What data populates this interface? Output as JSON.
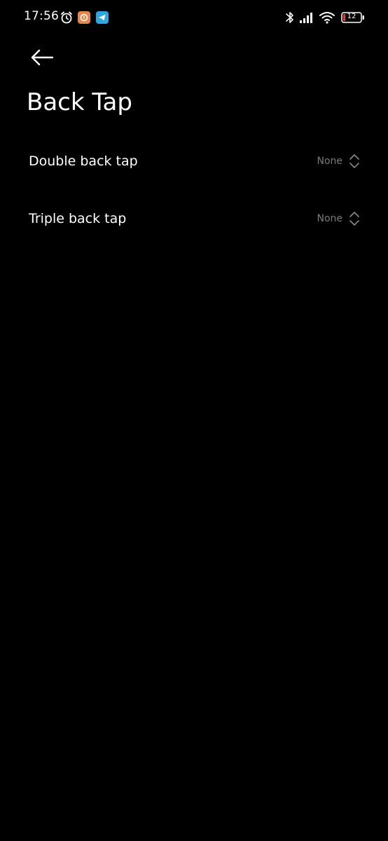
{
  "status_bar": {
    "time": "17:56",
    "battery_level": "12",
    "icons": [
      "alarm-icon",
      "app-notification-icon",
      "telegram-icon",
      "bluetooth-icon",
      "signal-icon",
      "wifi-icon",
      "battery-icon"
    ]
  },
  "header": {
    "back_icon": "arrow-left-icon",
    "title": "Back Tap"
  },
  "settings": [
    {
      "label": "Double back tap",
      "value": "None"
    },
    {
      "label": "Triple back tap",
      "value": "None"
    }
  ],
  "colors": {
    "background": "#000000",
    "text": "#ffffff",
    "secondary_text": "#7a7a7a",
    "battery_low": "#e53935",
    "notification_orange": "#e8864a",
    "telegram_blue": "#2ea6e0"
  }
}
